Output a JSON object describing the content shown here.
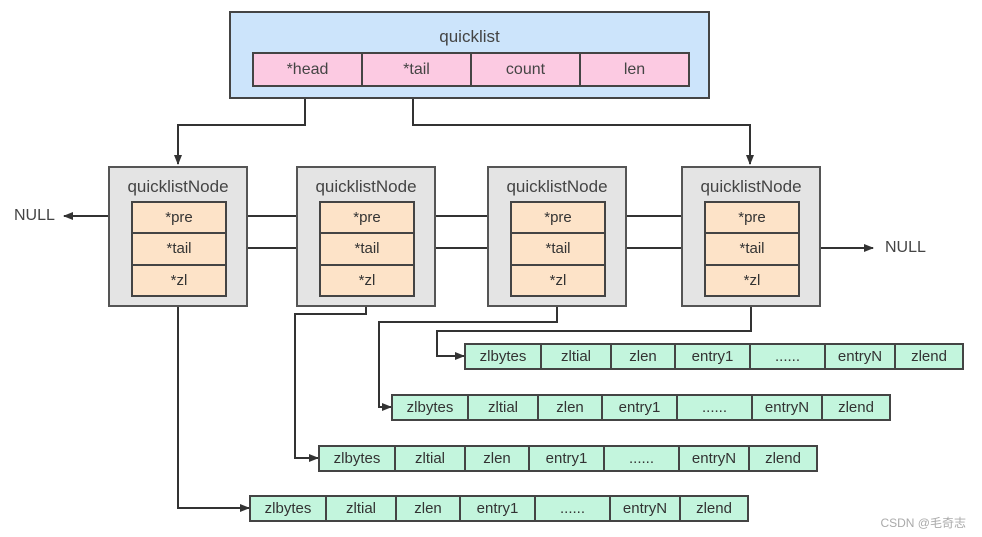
{
  "quicklist": {
    "title": "quicklist",
    "fields": [
      "*head",
      "*tail",
      "count",
      "len"
    ]
  },
  "nodes": [
    {
      "title": "quicklistNode",
      "fields": [
        "*pre",
        "*tail",
        "*zl"
      ]
    },
    {
      "title": "quicklistNode",
      "fields": [
        "*pre",
        "*tail",
        "*zl"
      ]
    },
    {
      "title": "quicklistNode",
      "fields": [
        "*pre",
        "*tail",
        "*zl"
      ]
    },
    {
      "title": "quicklistNode",
      "fields": [
        "*pre",
        "*tail",
        "*zl"
      ]
    }
  ],
  "null_left": "NULL",
  "null_right": "NULL",
  "ziplists": [
    {
      "cells": [
        "zlbytes",
        "zltial",
        "zlen",
        "entry1",
        "......",
        "entryN",
        "zlend"
      ]
    },
    {
      "cells": [
        "zlbytes",
        "zltial",
        "zlen",
        "entry1",
        "......",
        "entryN",
        "zlend"
      ]
    },
    {
      "cells": [
        "zlbytes",
        "zltial",
        "zlen",
        "entry1",
        "......",
        "entryN",
        "zlend"
      ]
    },
    {
      "cells": [
        "zlbytes",
        "zltial",
        "zlen",
        "entry1",
        "......",
        "entryN",
        "zlend"
      ]
    }
  ],
  "watermark": "CSDN @毛奇志",
  "colors": {
    "quicklist_bg": "#cce4fb",
    "quicklist_field_bg": "#fccae2",
    "node_bg": "#e4e4e4",
    "node_field_bg": "#fde3c8",
    "ziplist_bg": "#c3f5dd",
    "line": "#333333"
  }
}
